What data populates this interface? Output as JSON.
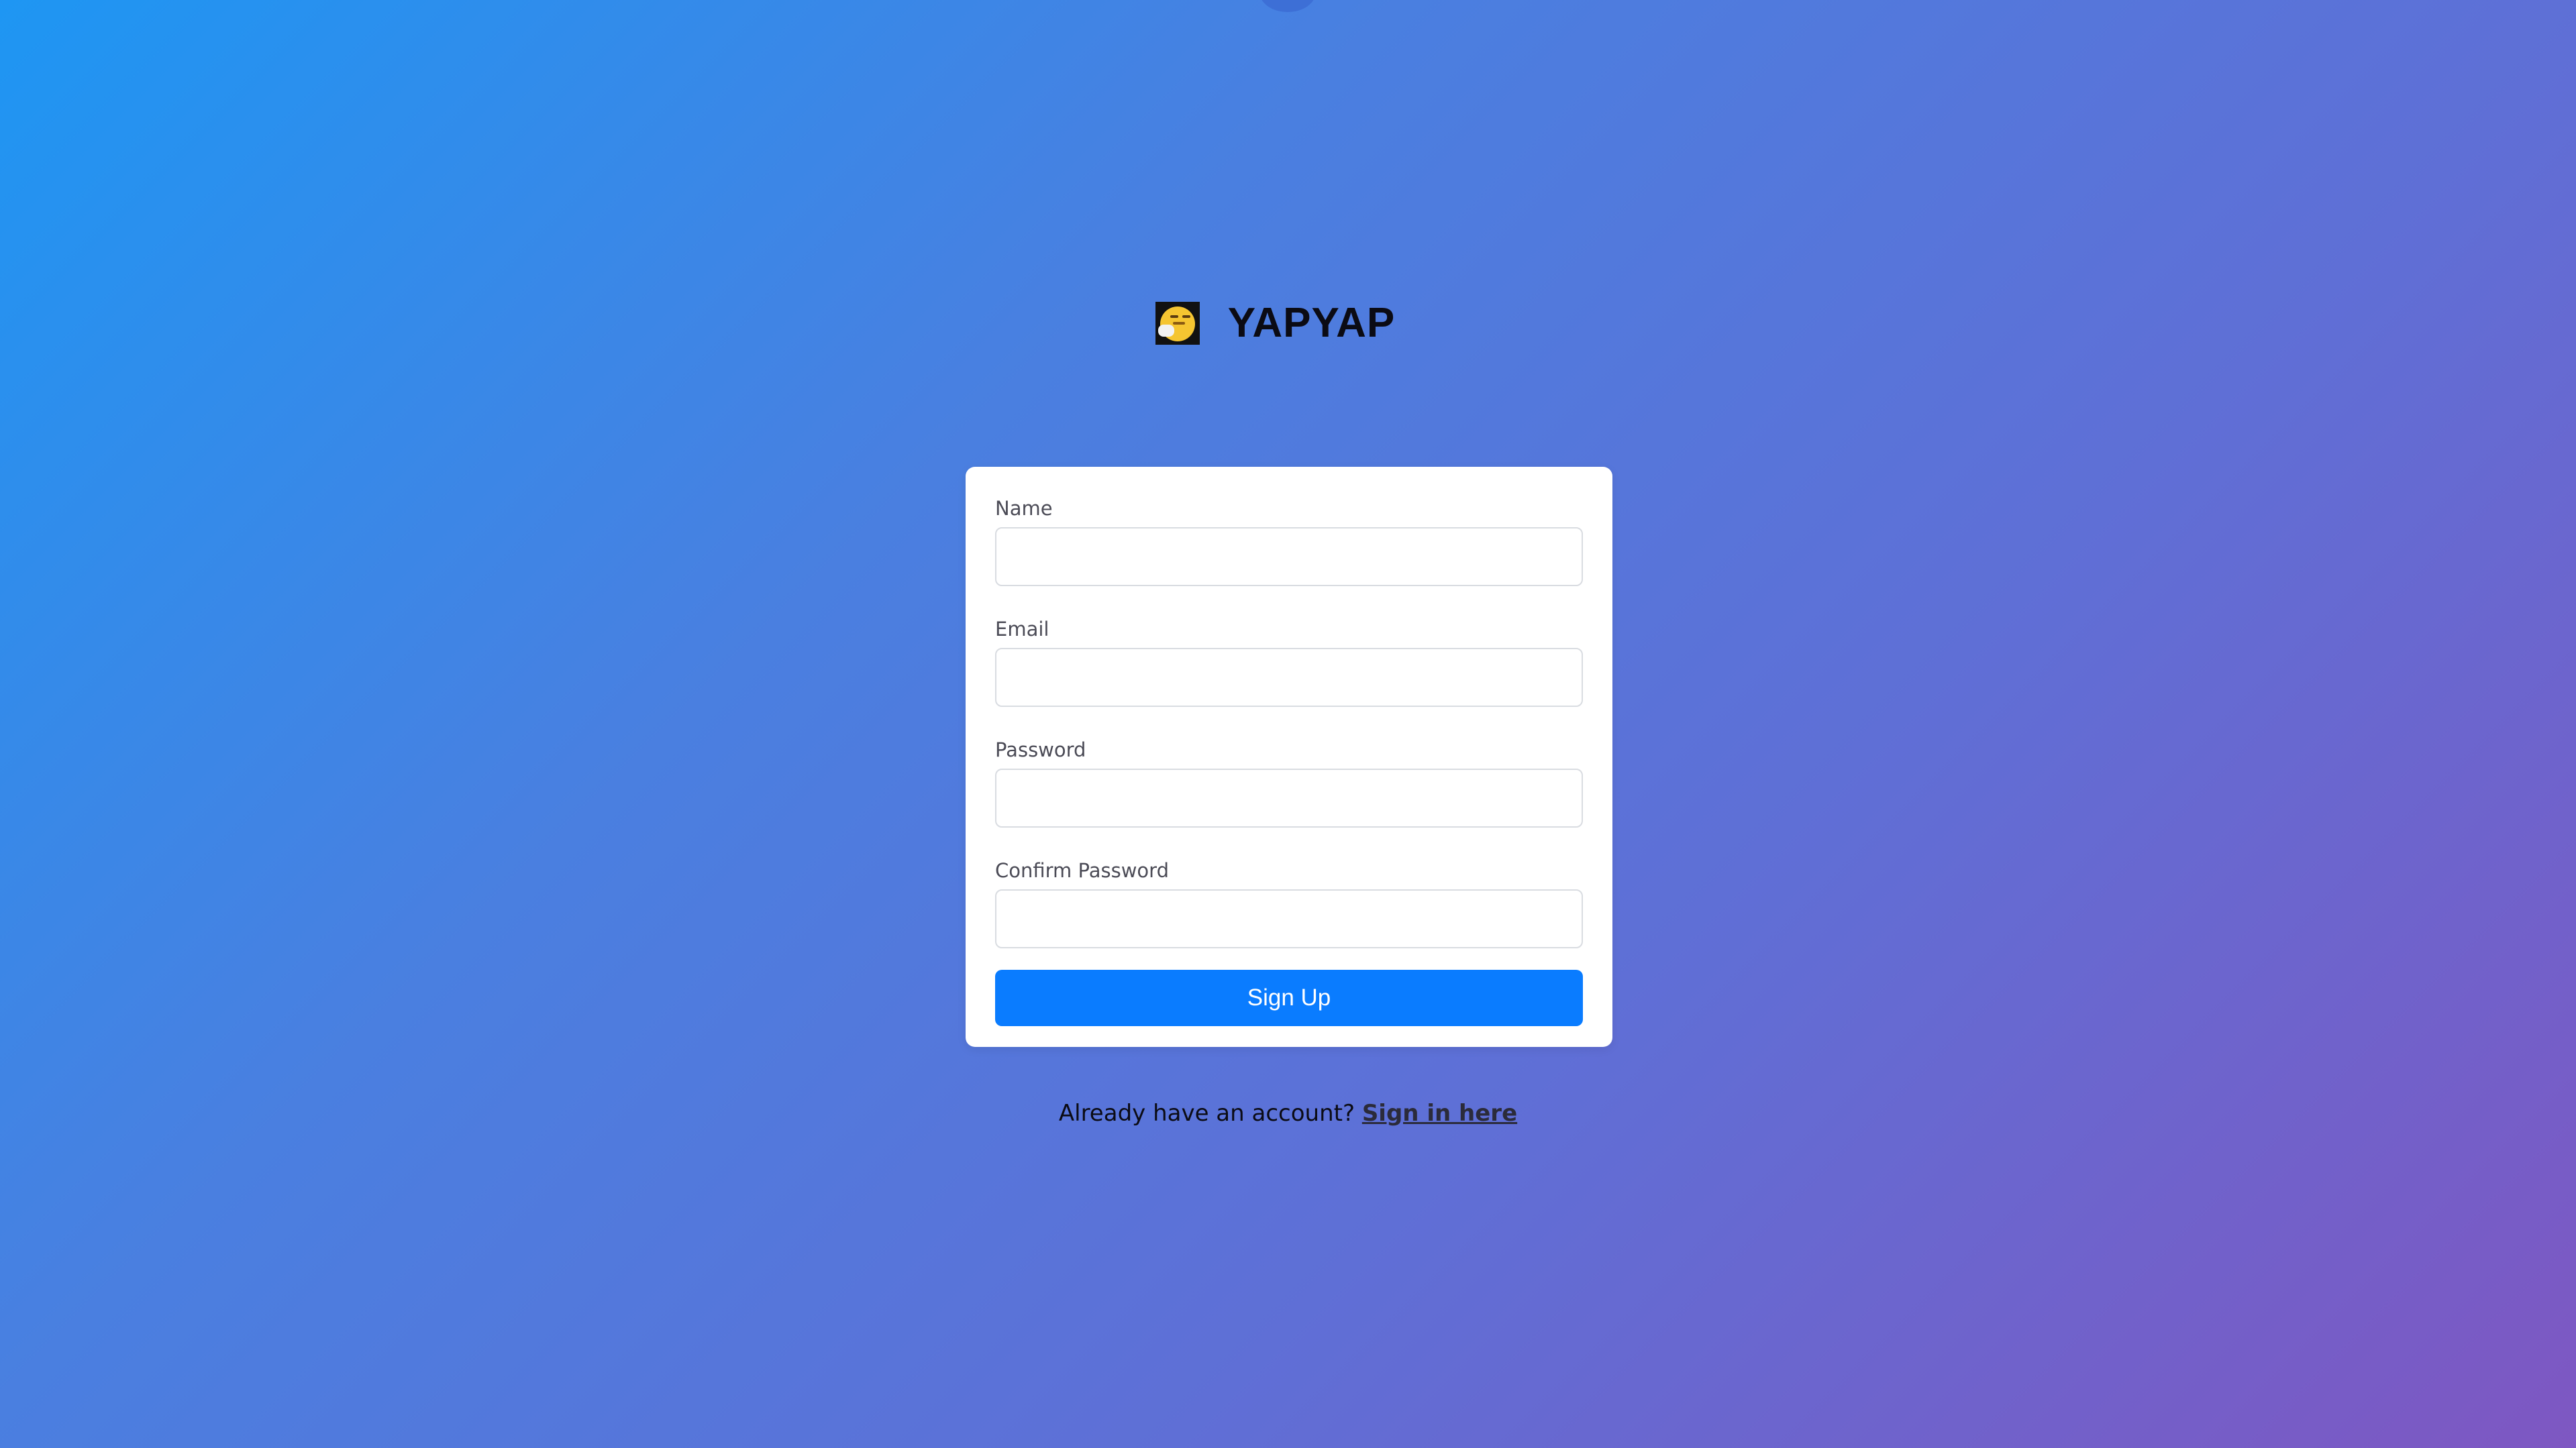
{
  "brand": {
    "name": "YAPYAP",
    "logo_icon": "yawning-face-emoji"
  },
  "form": {
    "fields": [
      {
        "label": "Name",
        "value": "",
        "placeholder": ""
      },
      {
        "label": "Email",
        "value": "",
        "placeholder": ""
      },
      {
        "label": "Password",
        "value": "",
        "placeholder": ""
      },
      {
        "label": "Confirm Password",
        "value": "",
        "placeholder": ""
      }
    ],
    "submit_label": "Sign Up"
  },
  "footer": {
    "prompt": "Already have an account?",
    "link_label": "Sign in here"
  },
  "colors": {
    "background_start": "#1e96f3",
    "background_end": "#7e57c2",
    "button": "#0a7cff"
  }
}
